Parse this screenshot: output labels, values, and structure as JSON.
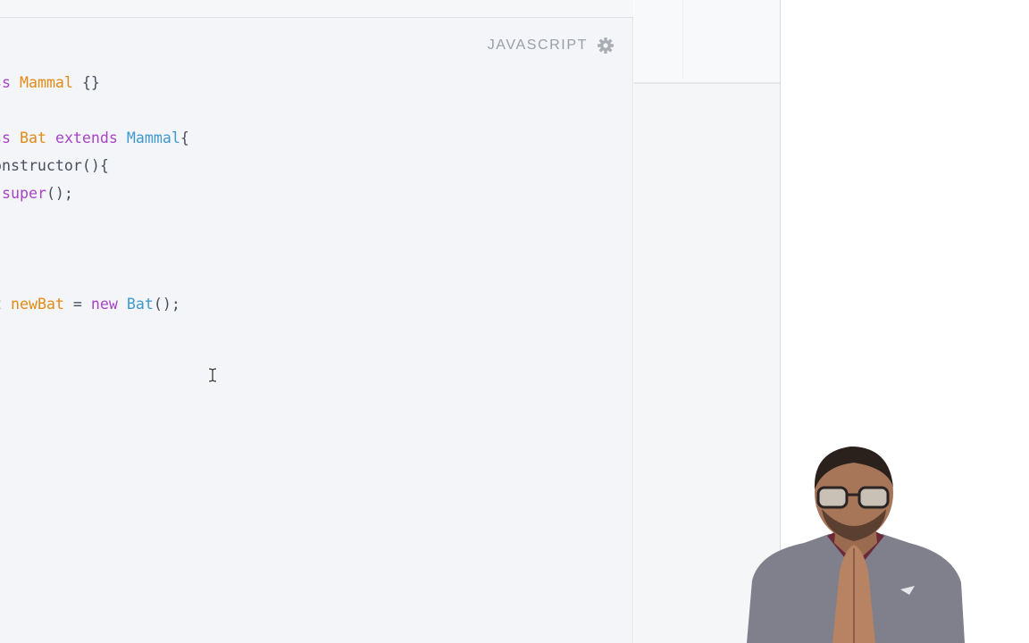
{
  "editor": {
    "language": "JAVASCRIPT",
    "settings_icon": "gear-icon",
    "lines": [
      [
        {
          "t": "lass",
          "c": "kw"
        },
        {
          "t": " ",
          "c": "punc"
        },
        {
          "t": "Mammal",
          "c": "cls"
        },
        {
          "t": " {}",
          "c": "punc"
        }
      ],
      [],
      [
        {
          "t": "lass",
          "c": "kw"
        },
        {
          "t": " ",
          "c": "punc"
        },
        {
          "t": "Bat",
          "c": "cls"
        },
        {
          "t": " ",
          "c": "punc"
        },
        {
          "t": "extends",
          "c": "kw"
        },
        {
          "t": " ",
          "c": "punc"
        },
        {
          "t": "Mammal",
          "c": "ref"
        },
        {
          "t": "{",
          "c": "punc"
        }
      ],
      [
        {
          "t": " constructor(){",
          "c": "punc"
        }
      ],
      [
        {
          "t": "   ",
          "c": "punc"
        },
        {
          "t": "super",
          "c": "fn"
        },
        {
          "t": "();",
          "c": "punc"
        }
      ],
      [
        {
          "t": " }",
          "c": "punc"
        }
      ],
      [],
      [],
      [
        {
          "t": "nst",
          "c": "kw"
        },
        {
          "t": " ",
          "c": "punc"
        },
        {
          "t": "newBat",
          "c": "var"
        },
        {
          "t": " = ",
          "c": "punc"
        },
        {
          "t": "new",
          "c": "kw"
        },
        {
          "t": " ",
          "c": "punc"
        },
        {
          "t": "Bat",
          "c": "ref"
        },
        {
          "t": "();",
          "c": "punc"
        }
      ]
    ],
    "colors": {
      "keyword": "#a743c6",
      "class_name": "#e38b15",
      "reference": "#3f99cf",
      "punctuation": "#4a4f5c"
    }
  },
  "cursor": {
    "icon": "text-cursor-icon"
  },
  "webcam": {
    "subject": "presenter-webcam"
  }
}
